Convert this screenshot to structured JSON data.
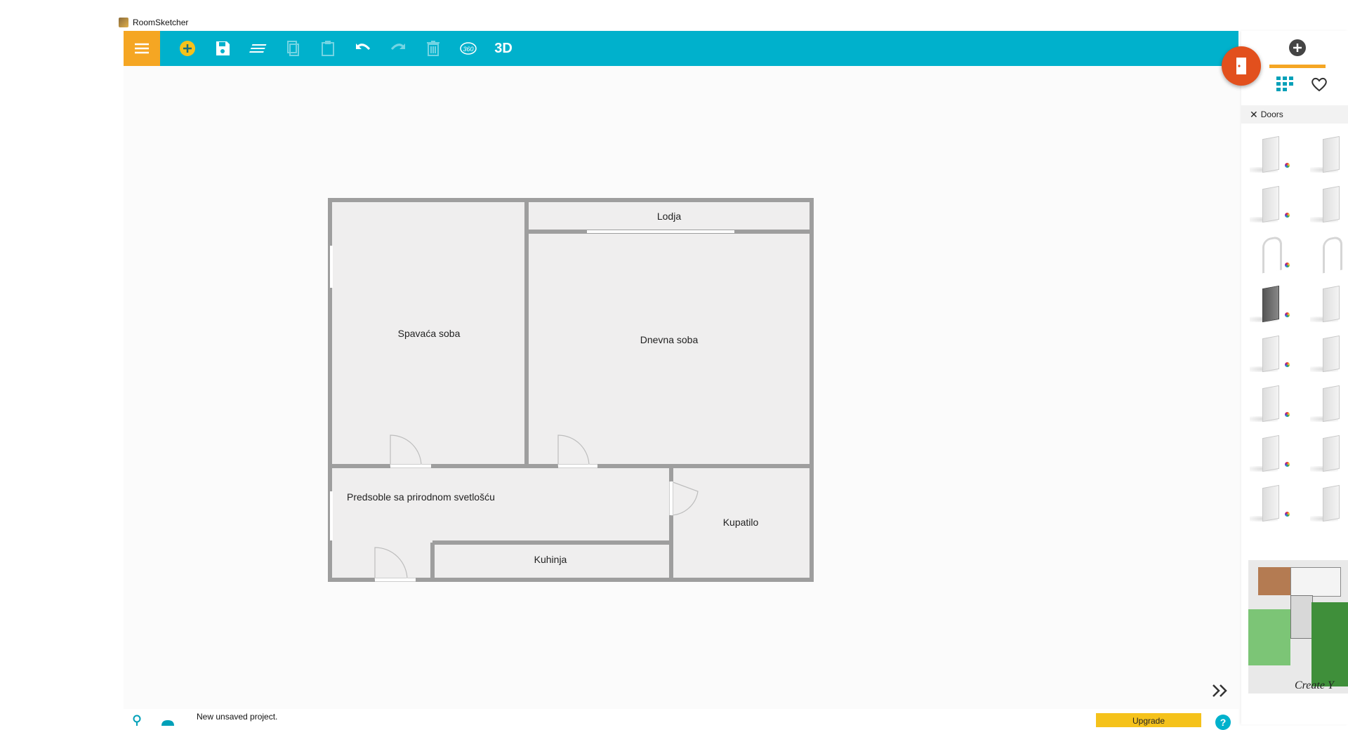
{
  "window": {
    "title": "RoomSketcher"
  },
  "toolbar": {
    "menu_icon": "hamburger-icon",
    "tools": [
      {
        "name": "add",
        "icon": "plus-circle-icon",
        "disabled": false
      },
      {
        "name": "save",
        "icon": "save-icon",
        "disabled": false
      },
      {
        "name": "levels",
        "icon": "layers-icon",
        "disabled": false
      },
      {
        "name": "copy",
        "icon": "copy-icon",
        "disabled": true
      },
      {
        "name": "paste",
        "icon": "paste-icon",
        "disabled": true
      },
      {
        "name": "undo",
        "icon": "undo-icon",
        "disabled": false
      },
      {
        "name": "redo",
        "icon": "redo-icon",
        "disabled": true
      },
      {
        "name": "delete",
        "icon": "trash-icon",
        "disabled": true
      },
      {
        "name": "view-360",
        "icon": "360-icon",
        "label": "360",
        "disabled": false
      },
      {
        "name": "view-3d",
        "icon": "3d-icon",
        "label": "3D",
        "disabled": false
      }
    ]
  },
  "floorplan": {
    "rooms": [
      {
        "id": "spavaca",
        "label": "Spavaća soba"
      },
      {
        "id": "lodja",
        "label": "Lodja"
      },
      {
        "id": "dnevna",
        "label": "Dnevna soba"
      },
      {
        "id": "predsoble",
        "label": "Predsoble sa prirodnom svetlošću"
      },
      {
        "id": "kupatilo",
        "label": "Kupatilo"
      },
      {
        "id": "kuhinja",
        "label": "Kuhinja"
      }
    ]
  },
  "right_panel": {
    "add_tab_icon": "plus-circle-icon",
    "grid_icon": "grid-icon",
    "favorites_icon": "heart-icon",
    "filter": {
      "close_icon": "close-icon",
      "label": "Doors"
    },
    "door_items": 16,
    "preview_caption": "Create Y"
  },
  "fab": {
    "icon": "door-icon"
  },
  "statusbar": {
    "text": "New unsaved project.",
    "upgrade_label": "Upgrade",
    "help_label": "?",
    "expand_icon": "double-chevron-right-icon"
  },
  "colors": {
    "toolbar": "#00b1cc",
    "accent": "#f5a623",
    "fab": "#e2501d",
    "upgrade": "#f5c21b"
  }
}
